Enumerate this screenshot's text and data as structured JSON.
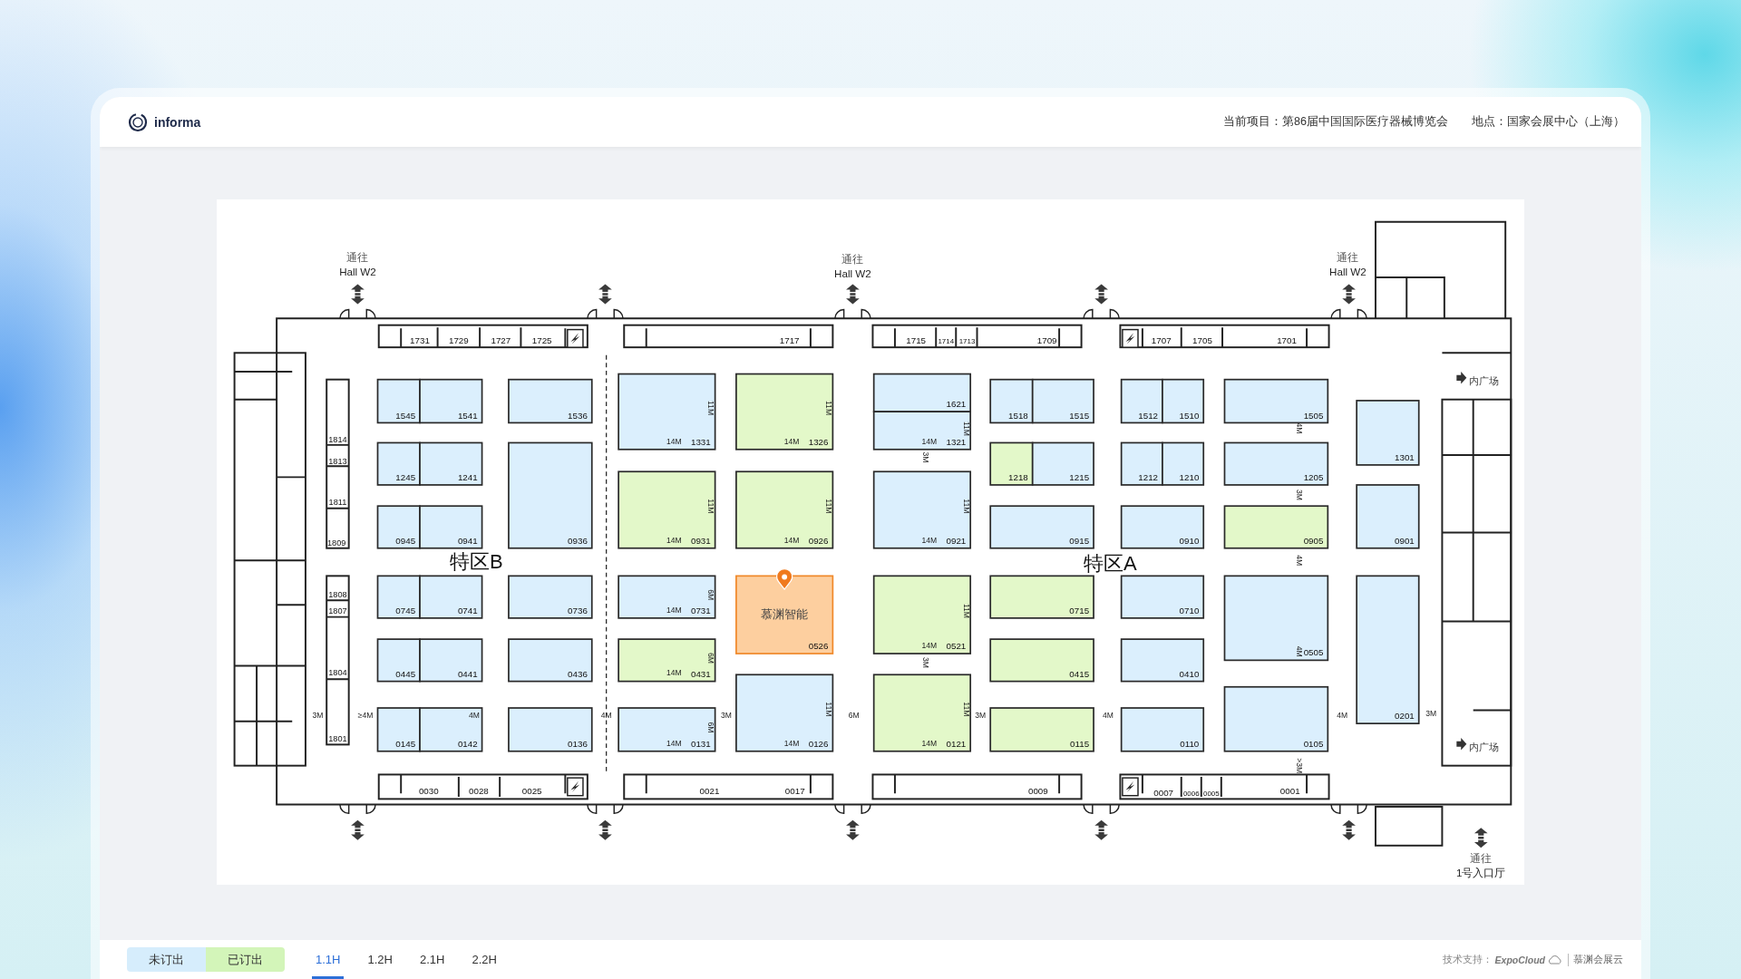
{
  "header": {
    "brand": "informa",
    "project": "当前项目：第86届中国国际医疗器械博览会",
    "venue": "地点：国家会展中心（上海）"
  },
  "floor_plan": {
    "directions": [
      {
        "line1": "通往",
        "line2": "Hall W2"
      },
      {
        "line1": "通往",
        "line2": "Hall W2"
      },
      {
        "line1": "通往",
        "line2": "Hall W2"
      },
      {
        "line1": "通往",
        "line2": "1号入口厅"
      }
    ],
    "plaza_labels": [
      "内广场",
      "内广场"
    ],
    "zones": [
      "特区B",
      "特区A"
    ],
    "booths": [
      {
        "number": "1545",
        "sold": false,
        "selected": false
      },
      {
        "number": "1541",
        "sold": false,
        "selected": false
      },
      {
        "number": "1245",
        "sold": false,
        "selected": false
      },
      {
        "number": "1241",
        "sold": false,
        "selected": false
      },
      {
        "number": "0945",
        "sold": false,
        "selected": false
      },
      {
        "number": "0941",
        "sold": false,
        "selected": false
      },
      {
        "number": "0745",
        "sold": false,
        "selected": false
      },
      {
        "number": "0741",
        "sold": false,
        "selected": false
      },
      {
        "number": "0445",
        "sold": false,
        "selected": false
      },
      {
        "number": "0441",
        "sold": false,
        "selected": false
      },
      {
        "number": "0145",
        "sold": false,
        "selected": false
      },
      {
        "number": "0142",
        "sold": false,
        "selected": false
      },
      {
        "number": "1536",
        "sold": false,
        "selected": false
      },
      {
        "number": "0936",
        "sold": false,
        "selected": false
      },
      {
        "number": "0736",
        "sold": false,
        "selected": false
      },
      {
        "number": "0436",
        "sold": false,
        "selected": false
      },
      {
        "number": "0136",
        "sold": false,
        "selected": false
      },
      {
        "number": "1331",
        "sold": false,
        "selected": false,
        "width": "14M",
        "depth": "11M"
      },
      {
        "number": "0931",
        "sold": true,
        "selected": false,
        "width": "14M",
        "depth": "11M"
      },
      {
        "number": "0731",
        "sold": false,
        "selected": false,
        "width": "14M",
        "depth": "6M"
      },
      {
        "number": "0431",
        "sold": true,
        "selected": false,
        "width": "14M",
        "depth": "6M"
      },
      {
        "number": "0131",
        "sold": false,
        "selected": false,
        "width": "14M",
        "depth": "6M"
      },
      {
        "number": "1326",
        "sold": true,
        "selected": false,
        "width": "14M",
        "depth": "11M"
      },
      {
        "number": "0926",
        "sold": true,
        "selected": false,
        "width": "14M",
        "depth": "11M"
      },
      {
        "number": "0526",
        "sold": true,
        "selected": true,
        "exhibitor": "慕渊智能"
      },
      {
        "number": "0126",
        "sold": false,
        "selected": false,
        "width": "14M",
        "depth": "11M"
      },
      {
        "number": "1621",
        "sold": false,
        "selected": false
      },
      {
        "number": "1321",
        "sold": false,
        "selected": false,
        "width": "14M",
        "depth": "11M"
      },
      {
        "number": "0921",
        "sold": false,
        "selected": false,
        "width": "14M",
        "depth": "11M"
      },
      {
        "number": "0521",
        "sold": true,
        "selected": false,
        "width": "14M",
        "depth": "11M"
      },
      {
        "number": "0121",
        "sold": true,
        "selected": false,
        "width": "14M",
        "depth": "11M"
      },
      {
        "number": "1518",
        "sold": false,
        "selected": false
      },
      {
        "number": "1515",
        "sold": false,
        "selected": false
      },
      {
        "number": "1218",
        "sold": true,
        "selected": false
      },
      {
        "number": "1215",
        "sold": false,
        "selected": false
      },
      {
        "number": "0915",
        "sold": false,
        "selected": false
      },
      {
        "number": "0715",
        "sold": true,
        "selected": false
      },
      {
        "number": "0415",
        "sold": true,
        "selected": false
      },
      {
        "number": "0115",
        "sold": true,
        "selected": false
      },
      {
        "number": "1512",
        "sold": false,
        "selected": false
      },
      {
        "number": "1510",
        "sold": false,
        "selected": false
      },
      {
        "number": "1212",
        "sold": false,
        "selected": false
      },
      {
        "number": "1210",
        "sold": false,
        "selected": false
      },
      {
        "number": "0910",
        "sold": false,
        "selected": false
      },
      {
        "number": "0710",
        "sold": false,
        "selected": false
      },
      {
        "number": "0410",
        "sold": false,
        "selected": false
      },
      {
        "number": "0110",
        "sold": false,
        "selected": false
      },
      {
        "number": "1505",
        "sold": false,
        "selected": false
      },
      {
        "number": "1205",
        "sold": false,
        "selected": false
      },
      {
        "number": "0905",
        "sold": true,
        "selected": false
      },
      {
        "number": "0505",
        "sold": false,
        "selected": false
      },
      {
        "number": "0105",
        "sold": false,
        "selected": false
      },
      {
        "number": "1301",
        "sold": false,
        "selected": false
      },
      {
        "number": "0901",
        "sold": false,
        "selected": false
      },
      {
        "number": "0201",
        "sold": false,
        "selected": false
      }
    ],
    "strip_booths": [
      "1731",
      "1729",
      "1727",
      "1725",
      "1717",
      "1715",
      "1714",
      "1713",
      "1709",
      "1707",
      "1705",
      "1701",
      "0030",
      "0028",
      "0025",
      "0021",
      "0017",
      "0009",
      "0007",
      "0006",
      "0005",
      "0001"
    ],
    "side_booths": [
      "1814",
      "1813",
      "1811",
      "1809",
      "1808",
      "1807",
      "1804",
      "1801"
    ],
    "aisle_widths": [
      "3M",
      "≥4M",
      "4M",
      "4M",
      "3M",
      "6M",
      "3M",
      "3M",
      "3M",
      "4M",
      "4M",
      "3M",
      "4M",
      "4M",
      "4M",
      "3M",
      ">3M"
    ]
  },
  "legend": [
    {
      "label": "未订出",
      "color": "#d6edfc"
    },
    {
      "label": "已订出",
      "color": "#d3f5b9"
    }
  ],
  "tabs": [
    {
      "label": "1.1H",
      "selected": true
    },
    {
      "label": "1.2H",
      "selected": false
    },
    {
      "label": "2.1H",
      "selected": false
    },
    {
      "label": "2.2H",
      "selected": false
    }
  ],
  "footer": {
    "support_label": "技术支持：",
    "support_brand": "ExpoCloud",
    "support_company": "慕渊会展云"
  }
}
